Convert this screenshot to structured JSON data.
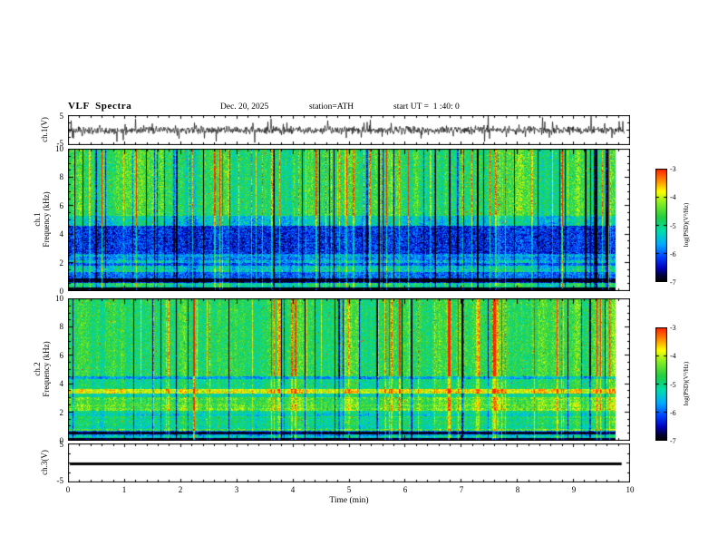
{
  "header": {
    "title": "VLF  Spectra",
    "date": "Dec. 20, 2025",
    "station": "station=ATH",
    "start_ut": "start UT =  1 :40: 0"
  },
  "axes": {
    "time_label": "Time (min)",
    "x_ticks": [
      "0",
      "1",
      "2",
      "3",
      "4",
      "5",
      "6",
      "7",
      "8",
      "9",
      "10"
    ],
    "wave_yticks": [
      "5",
      "-5"
    ],
    "freq_ticks": [
      "10",
      "8",
      "6",
      "4",
      "2",
      "0"
    ],
    "colorbar_ticks": [
      "-3",
      "-4",
      "-5",
      "-6",
      "-7"
    ],
    "ch1_wave_label": "ch.1(V)",
    "ch3_wave_label": "ch.3(V)",
    "spec1_label": "ch.1\nFrequency (kHz)",
    "spec2_label": "ch.2\nFrequency (kHz)",
    "colorbar_label": "log(PSD)(V²/Hz)"
  },
  "colormap": [
    [
      0.0,
      "#000000"
    ],
    [
      0.05,
      "#000033"
    ],
    [
      0.12,
      "#0000bb"
    ],
    [
      0.22,
      "#0044ff"
    ],
    [
      0.33,
      "#00aaff"
    ],
    [
      0.45,
      "#00ddaa"
    ],
    [
      0.57,
      "#22cc44"
    ],
    [
      0.7,
      "#88ee22"
    ],
    [
      0.8,
      "#ffff00"
    ],
    [
      0.9,
      "#ff8800"
    ],
    [
      1.0,
      "#ff2200"
    ]
  ],
  "chart_data": [
    {
      "type": "line",
      "name": "ch1_waveform",
      "ylabel": "ch.1(V)",
      "ylim": [
        -5,
        5
      ],
      "yticks": [
        5,
        -5
      ],
      "xlim": [
        0,
        10
      ],
      "xlabel": "Time (min)",
      "description": "Continuous broadband noise centered on 0 V, typical excursions ±1.5 V with frequent impulsive spikes reaching about ±4 V across the whole 0-10 min record",
      "seed": 11,
      "amplitude": 1.25,
      "spike_rate": 0.06,
      "spike_amp": 2.6,
      "data_end_fraction": 0.99
    },
    {
      "type": "heatmap",
      "name": "ch1_spectrogram",
      "ylabel": "ch.1 Frequency (kHz)",
      "ylim": [
        0,
        10
      ],
      "yticks": [
        0,
        2,
        4,
        6,
        8,
        10
      ],
      "xlim": [
        0,
        10
      ],
      "value_label": "log(PSD)(V²/Hz)",
      "value_range": [
        -7,
        -3
      ],
      "colorbar_ticks": [
        -3,
        -4,
        -5,
        -6,
        -7
      ],
      "legend_position": "right-colorbar",
      "description": "Green speckled background (~-4.8) above ~5 kHz with red/yellow hot pixels and many dark vertical dropout streaks; dark-blue quiet band (~-6.3) between ~2.6-4.6 kHz; horizontally striped blue/cyan bands (~-5.2 to -6.6) below 2.6 kHz; black band (-7) at 0-0.25 kHz; data ends ~9.75 min",
      "seed": 21,
      "bands": [
        {
          "f0": 0.0,
          "f1": 0.25,
          "v": -7.0
        },
        {
          "f0": 0.25,
          "f1": 0.6,
          "v": -5.15
        },
        {
          "f0": 0.6,
          "f1": 0.9,
          "v": -6.55
        },
        {
          "f0": 0.9,
          "f1": 1.35,
          "v": -5.45
        },
        {
          "f0": 1.35,
          "f1": 2.6,
          "v": -5.7
        },
        {
          "f0": 2.6,
          "f1": 4.6,
          "v": -6.25
        },
        {
          "f0": 4.6,
          "f1": 5.3,
          "v": -5.35
        },
        {
          "f0": 5.3,
          "f1": 10.0,
          "v": -4.75
        }
      ],
      "stripe_max_f": 2.6,
      "stripe_amp": 0.55,
      "noise": 0.5,
      "col_mod": 0.45,
      "streak_count": 110,
      "dark_streak_fraction": 0.45,
      "speckle_rate": 0.004,
      "speckle_amp": 1.9,
      "data_end_fraction": 0.975
    },
    {
      "type": "heatmap",
      "name": "ch2_spectrogram",
      "ylabel": "ch.2 Frequency (kHz)",
      "ylim": [
        0,
        10
      ],
      "yticks": [
        0,
        2,
        4,
        6,
        8,
        10
      ],
      "xlim": [
        0,
        10
      ],
      "value_label": "log(PSD)(V²/Hz)",
      "value_range": [
        -7,
        -3
      ],
      "colorbar_ticks": [
        -3,
        -4,
        -5,
        -6,
        -7
      ],
      "legend_position": "right-colorbar",
      "description": "Green speckled background (~-4.7) above ~4.5 kHz with vertical streaks; bright yellow/red horizontal line (~-3.8) near 3.5 kHz; strongly striped green/yellow/blue horizontal bands (~-4.2 to -5.8) from 0.7-3.3 kHz; thin dark bands near 0.5 and 0.1 kHz; data ends ~9.75 min",
      "seed": 31,
      "bands": [
        {
          "f0": 0.0,
          "f1": 0.2,
          "v": -6.7
        },
        {
          "f0": 0.2,
          "f1": 0.45,
          "v": -5.0
        },
        {
          "f0": 0.45,
          "f1": 0.7,
          "v": -6.3
        },
        {
          "f0": 0.7,
          "f1": 3.3,
          "v": -5.0
        },
        {
          "f0": 3.3,
          "f1": 3.65,
          "v": -3.8
        },
        {
          "f0": 3.65,
          "f1": 4.35,
          "v": -4.9
        },
        {
          "f0": 4.35,
          "f1": 4.55,
          "v": -5.6
        },
        {
          "f0": 4.55,
          "f1": 10.0,
          "v": -4.7
        }
      ],
      "stripe_max_f": 3.3,
      "stripe_amp": 0.8,
      "noise": 0.45,
      "col_mod": 0.4,
      "streak_count": 80,
      "dark_streak_fraction": 0.3,
      "speckle_rate": 0.003,
      "speckle_amp": 1.8,
      "data_end_fraction": 0.975
    },
    {
      "type": "line",
      "name": "ch3_waveform",
      "ylabel": "ch.3(V)",
      "ylim": [
        -5,
        5
      ],
      "yticks": [
        5,
        -5
      ],
      "xlim": [
        0,
        10
      ],
      "constant_value": 0,
      "line_width": 3,
      "data_end_fraction": 0.985,
      "description": "Flat thick black trace at exactly 0 V for the whole record (inactive channel)"
    }
  ]
}
